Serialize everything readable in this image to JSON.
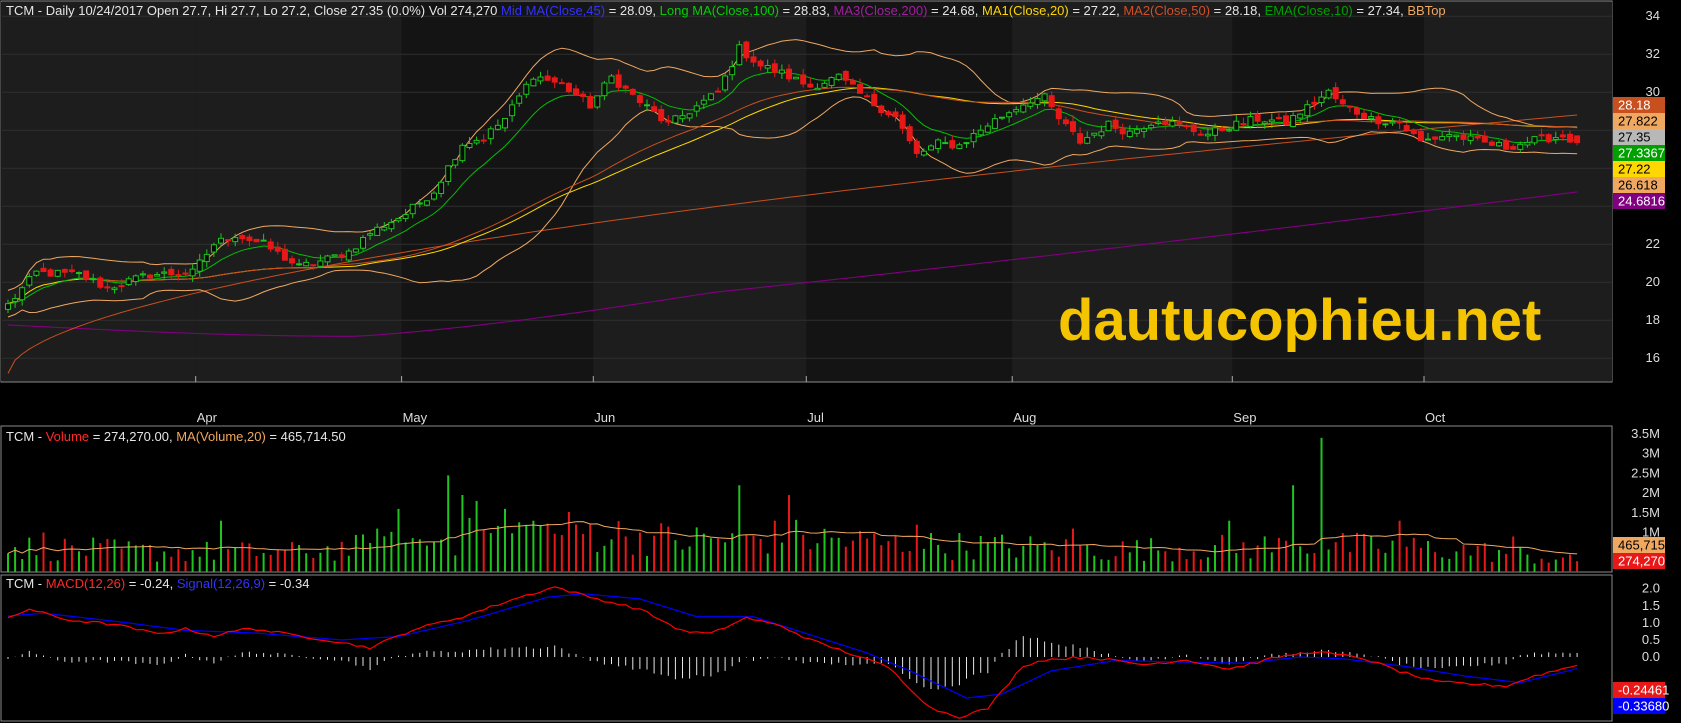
{
  "watermark": "dautucophieu.net",
  "price_header": {
    "prefix": "TCM - Daily 10/24/2017 Open 27.7, Hi 27.7, Lo 27.2, Close 27.35 (0.0%) Vol 274,270",
    "mid_ma_label": "Mid MA(Close,45)",
    "mid_ma_value": " = 28.09,",
    "long_ma_label": "Long MA(Close,100)",
    "long_ma_value": " = 28.83,",
    "ma3_label": "MA3(Close,200)",
    "ma3_value": " = 24.68,",
    "ma1_label": "MA1(Close,20)",
    "ma1_value": " = 27.22,",
    "ma2_label": "MA2(Close,50)",
    "ma2_value": " = 28.18,",
    "ema_label": "EMA(Close,10)",
    "ema_value": " = 27.34,",
    "bb_label": "BBTop"
  },
  "volume_header": {
    "prefix": "TCM - ",
    "vol_label": "Volume",
    "vol_value": " = 274,270.00, ",
    "ma_label": "MA(Volume,20)",
    "ma_value": " = 465,714.50"
  },
  "macd_header": {
    "prefix": "TCM - ",
    "macd_label": "MACD(12,26)",
    "macd_value": " = -0.24, ",
    "signal_label": "Signal(12,26,9)",
    "signal_value": " = -0.34"
  },
  "colors": {
    "up": "#1fc41f",
    "down": "#e81818",
    "mid_ma": "#0000ff",
    "long_ma": "#00c000",
    "ma3": "#800080",
    "ma1": "#ffd700",
    "ma2": "#c84f1e",
    "ema": "#007f00",
    "bb": "#f0a860",
    "volume": "#ff1a1a",
    "vol_ma": "#f0a860",
    "macd": "#ff0000",
    "signal": "#0000ff"
  },
  "price_tags": [
    {
      "text": "28.18",
      "bg": "#c84f1e",
      "fg": "#ffffff"
    },
    {
      "text": "27.822",
      "bg": "#f0a860",
      "fg": "#000000"
    },
    {
      "text": "27.35",
      "bg": "#b8b8b8",
      "fg": "#000000"
    },
    {
      "text": "27.3367",
      "bg": "#00a000",
      "fg": "#ffffff"
    },
    {
      "text": "27.22",
      "bg": "#ffd700",
      "fg": "#000000"
    },
    {
      "text": "26.618",
      "bg": "#f0a860",
      "fg": "#000000"
    },
    {
      "text": "24.6816",
      "bg": "#800080",
      "fg": "#ffffff"
    }
  ],
  "volume_tags": [
    {
      "text": "465,715",
      "bg": "#f0a860",
      "fg": "#000000"
    },
    {
      "text": "274,270",
      "bg": "#e81818",
      "fg": "#ffffff"
    }
  ],
  "macd_tags": [
    {
      "text": "-0.24461",
      "bg": "#e81818",
      "fg": "#ffffff"
    },
    {
      "text": "-0.33680",
      "bg": "#0000ff",
      "fg": "#ffffff"
    }
  ],
  "chart_data": {
    "type": "candlestick",
    "months": [
      "Apr",
      "May",
      "Jun",
      "Jul",
      "Aug",
      "Sep",
      "Oct"
    ],
    "month_start_index": [
      27,
      56,
      83,
      113,
      142,
      173,
      200
    ],
    "price_axis": {
      "ticks": [
        16,
        18,
        20,
        22,
        24,
        26,
        28,
        30,
        32,
        34
      ],
      "tick_labels": [
        "16",
        "18",
        "20",
        "22",
        "",
        "",
        "",
        "30",
        "32",
        "34"
      ],
      "range": [
        14.8,
        34.8
      ]
    },
    "volume_axis": {
      "ticks": [
        1000000,
        1500000,
        2000000,
        2500000,
        3000000,
        3500000
      ],
      "tick_labels": [
        "1M",
        "1.5M",
        "2M",
        "2.5M",
        "3M",
        "3.5M"
      ],
      "range": [
        0,
        3700000
      ]
    },
    "macd_axis": {
      "ticks": [
        0.0,
        0.5,
        1.0,
        1.5,
        2.0
      ],
      "tick_labels": [
        "0.0",
        "0.5",
        "1.0",
        "1.5",
        "2.0"
      ],
      "range": [
        -1.9,
        2.4
      ]
    },
    "close_anchors": [
      [
        0,
        18.8
      ],
      [
        4,
        20.5
      ],
      [
        10,
        20.4
      ],
      [
        14,
        19.7
      ],
      [
        20,
        20.4
      ],
      [
        26,
        20.5
      ],
      [
        29,
        22.0
      ],
      [
        32,
        22.5
      ],
      [
        36,
        22.0
      ],
      [
        41,
        20.8
      ],
      [
        44,
        21.1
      ],
      [
        48,
        21.6
      ],
      [
        51,
        22.6
      ],
      [
        56,
        23.6
      ],
      [
        60,
        24.8
      ],
      [
        64,
        27.3
      ],
      [
        67,
        27.6
      ],
      [
        70,
        28.6
      ],
      [
        74,
        30.9
      ],
      [
        78,
        30.4
      ],
      [
        82,
        29.3
      ],
      [
        85,
        30.8
      ],
      [
        89,
        29.5
      ],
      [
        93,
        28.3
      ],
      [
        96,
        29.0
      ],
      [
        100,
        30.0
      ],
      [
        103,
        32.3
      ],
      [
        106,
        31.4
      ],
      [
        109,
        31.0
      ],
      [
        113,
        30.3
      ],
      [
        117,
        30.8
      ],
      [
        121,
        29.6
      ],
      [
        125,
        28.7
      ],
      [
        128,
        26.7
      ],
      [
        131,
        27.3
      ],
      [
        134,
        27.2
      ],
      [
        138,
        28.3
      ],
      [
        142,
        29.2
      ],
      [
        144,
        29.6
      ],
      [
        146,
        29.7
      ],
      [
        148,
        28.6
      ],
      [
        151,
        27.4
      ],
      [
        155,
        28.3
      ],
      [
        158,
        27.9
      ],
      [
        162,
        28.6
      ],
      [
        166,
        28.1
      ],
      [
        169,
        27.8
      ],
      [
        172,
        28.2
      ],
      [
        176,
        28.6
      ],
      [
        180,
        28.4
      ],
      [
        183,
        29.2
      ],
      [
        186,
        30.0
      ],
      [
        188,
        29.3
      ],
      [
        192,
        28.6
      ],
      [
        196,
        28.4
      ],
      [
        199,
        27.4
      ],
      [
        203,
        27.8
      ],
      [
        207,
        27.4
      ],
      [
        211,
        27.1
      ],
      [
        214,
        27.4
      ],
      [
        217,
        27.6
      ],
      [
        219,
        27.7
      ],
      [
        221,
        27.35
      ]
    ],
    "volume_anchors": [
      [
        0,
        630000
      ],
      [
        20,
        520000
      ],
      [
        40,
        500000
      ],
      [
        55,
        700000
      ],
      [
        70,
        1000000
      ],
      [
        80,
        1050000
      ],
      [
        95,
        800000
      ],
      [
        110,
        900000
      ],
      [
        125,
        700000
      ],
      [
        140,
        650000
      ],
      [
        155,
        560000
      ],
      [
        170,
        620000
      ],
      [
        185,
        680000
      ],
      [
        200,
        600000
      ],
      [
        210,
        500000
      ],
      [
        221,
        274270
      ]
    ],
    "volume_spikes": [
      [
        5,
        1000000
      ],
      [
        30,
        1300000
      ],
      [
        52,
        1100000
      ],
      [
        55,
        1600000
      ],
      [
        62,
        2450000
      ],
      [
        64,
        1950000
      ],
      [
        66,
        1800000
      ],
      [
        70,
        1600000
      ],
      [
        74,
        1300000
      ],
      [
        103,
        2200000
      ],
      [
        110,
        1950000
      ],
      [
        128,
        1200000
      ],
      [
        150,
        1100000
      ],
      [
        172,
        1300000
      ],
      [
        181,
        2200000
      ],
      [
        185,
        3400000
      ],
      [
        196,
        1300000
      ],
      [
        212,
        900000
      ]
    ],
    "macd_anchors": [
      [
        0,
        1.15
      ],
      [
        3,
        1.4
      ],
      [
        8,
        1.1
      ],
      [
        15,
        0.95
      ],
      [
        21,
        0.68
      ],
      [
        25,
        0.82
      ],
      [
        29,
        0.62
      ],
      [
        34,
        0.85
      ],
      [
        39,
        0.68
      ],
      [
        45,
        0.5
      ],
      [
        51,
        0.27
      ],
      [
        57,
        0.8
      ],
      [
        64,
        1.18
      ],
      [
        71,
        1.68
      ],
      [
        77,
        2.05
      ],
      [
        82,
        1.75
      ],
      [
        89,
        1.4
      ],
      [
        95,
        0.76
      ],
      [
        99,
        0.68
      ],
      [
        104,
        1.15
      ],
      [
        109,
        0.9
      ],
      [
        113,
        0.5
      ],
      [
        118,
        0.15
      ],
      [
        124,
        -0.3
      ],
      [
        130,
        -1.5
      ],
      [
        134,
        -1.75
      ],
      [
        138,
        -1.5
      ],
      [
        143,
        -0.25
      ],
      [
        146,
        -0.08
      ],
      [
        152,
        0.0
      ],
      [
        160,
        -0.22
      ],
      [
        166,
        -0.08
      ],
      [
        172,
        -0.35
      ],
      [
        179,
        0.0
      ],
      [
        184,
        0.16
      ],
      [
        191,
        -0.04
      ],
      [
        196,
        -0.42
      ],
      [
        201,
        -0.72
      ],
      [
        211,
        -0.85
      ],
      [
        215,
        -0.55
      ],
      [
        221,
        -0.24
      ]
    ],
    "signal_anchors": [
      [
        0,
        1.2
      ],
      [
        5,
        1.28
      ],
      [
        15,
        1.05
      ],
      [
        25,
        0.78
      ],
      [
        35,
        0.7
      ],
      [
        47,
        0.5
      ],
      [
        55,
        0.6
      ],
      [
        65,
        1.08
      ],
      [
        76,
        1.75
      ],
      [
        81,
        1.85
      ],
      [
        89,
        1.7
      ],
      [
        97,
        1.18
      ],
      [
        105,
        1.18
      ],
      [
        113,
        0.65
      ],
      [
        121,
        0.12
      ],
      [
        127,
        -0.4
      ],
      [
        135,
        -1.2
      ],
      [
        140,
        -1.08
      ],
      [
        147,
        -0.4
      ],
      [
        156,
        -0.1
      ],
      [
        166,
        -0.15
      ],
      [
        174,
        -0.18
      ],
      [
        182,
        0.0
      ],
      [
        188,
        -0.05
      ],
      [
        197,
        -0.28
      ],
      [
        205,
        -0.55
      ],
      [
        213,
        -0.75
      ],
      [
        221,
        -0.34
      ]
    ],
    "n_bars": 222
  }
}
